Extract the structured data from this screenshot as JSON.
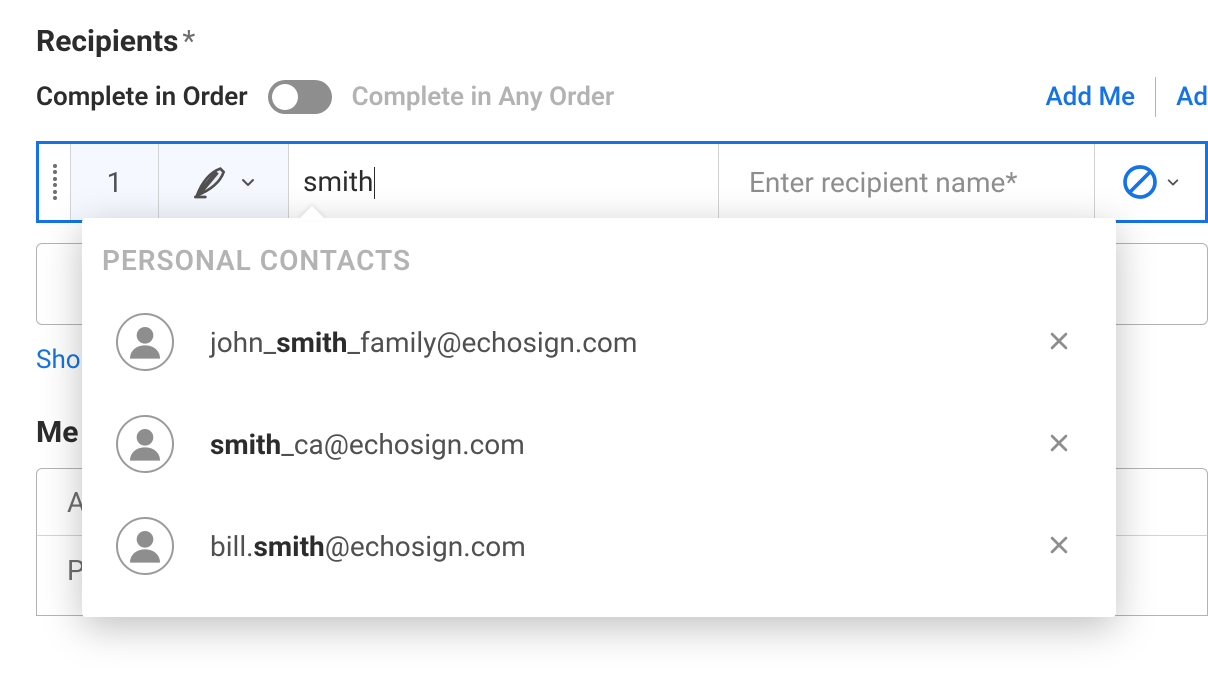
{
  "section": {
    "title": "Recipients",
    "required_mark": "*"
  },
  "order": {
    "in_order": "Complete in Order",
    "any_order": "Complete in Any Order"
  },
  "actions": {
    "add_me": "Add Me",
    "add_truncated": "Ad"
  },
  "row": {
    "number": "1",
    "email_value": "smith",
    "name_placeholder": "Enter recipient name*"
  },
  "dropdown": {
    "header": "PERSONAL CONTACTS",
    "match": "smith",
    "contacts": [
      {
        "pre": "john_",
        "match": "smith",
        "post": "_family@echosign.com"
      },
      {
        "pre": "",
        "match": "smith",
        "post": "_ca@echosign.com"
      },
      {
        "pre": "bill.",
        "match": "smith",
        "post": "@echosign.com"
      }
    ]
  },
  "behind": {
    "show_partial": "Sho",
    "message_heading_partial": "Me",
    "agreement_partial": "A",
    "please_partial": "P"
  }
}
